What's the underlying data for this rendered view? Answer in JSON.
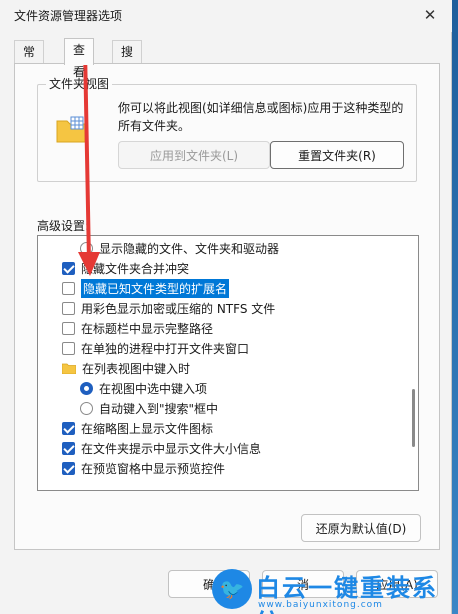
{
  "window": {
    "title": "文件资源管理器选项",
    "close_glyph": "✕"
  },
  "tabs": [
    {
      "label": "常规"
    },
    {
      "label": "查看"
    },
    {
      "label": "搜索"
    }
  ],
  "folder_views": {
    "legend": "文件夹视图",
    "description": "你可以将此视图(如详细信息或图标)应用于这种类型的所有文件夹。",
    "apply_button": "应用到文件夹(L)",
    "reset_button": "重置文件夹(R)"
  },
  "advanced": {
    "label": "高级设置:",
    "items": [
      {
        "type": "radio",
        "checked": false,
        "label": "显示隐藏的文件、文件夹和驱动器"
      },
      {
        "type": "checkbox",
        "checked": true,
        "label": "隐藏文件夹合并冲突"
      },
      {
        "type": "checkbox",
        "checked": false,
        "label": "隐藏已知文件类型的扩展名",
        "selected": true
      },
      {
        "type": "checkbox",
        "checked": false,
        "label": "用彩色显示加密或压缩的 NTFS 文件"
      },
      {
        "type": "checkbox",
        "checked": false,
        "label": "在标题栏中显示完整路径"
      },
      {
        "type": "checkbox",
        "checked": false,
        "label": "在单独的进程中打开文件夹窗口"
      },
      {
        "type": "folder",
        "label": "在列表视图中键入时"
      },
      {
        "type": "radio",
        "checked": true,
        "label": "在视图中选中键入项"
      },
      {
        "type": "radio",
        "checked": false,
        "label": "自动键入到\"搜索\"框中"
      },
      {
        "type": "checkbox",
        "checked": true,
        "label": "在缩略图上显示文件图标"
      },
      {
        "type": "checkbox",
        "checked": true,
        "label": "在文件夹提示中显示文件大小信息"
      },
      {
        "type": "checkbox",
        "checked": true,
        "label": "在预览窗格中显示预览控件"
      }
    ]
  },
  "restore_button": "还原为默认值(D)",
  "bottom_buttons": {
    "ok": "确",
    "cancel": "消",
    "apply": "应用(A)"
  },
  "watermark": {
    "brand": "白云一键重装系统",
    "url": "www.baiyunxitong.com",
    "logo_glyph": "🐦"
  },
  "colors": {
    "accent": "#0078d7",
    "check": "#1f5fbf",
    "watermark": "#1e88e5",
    "arrow": "#e53935"
  }
}
